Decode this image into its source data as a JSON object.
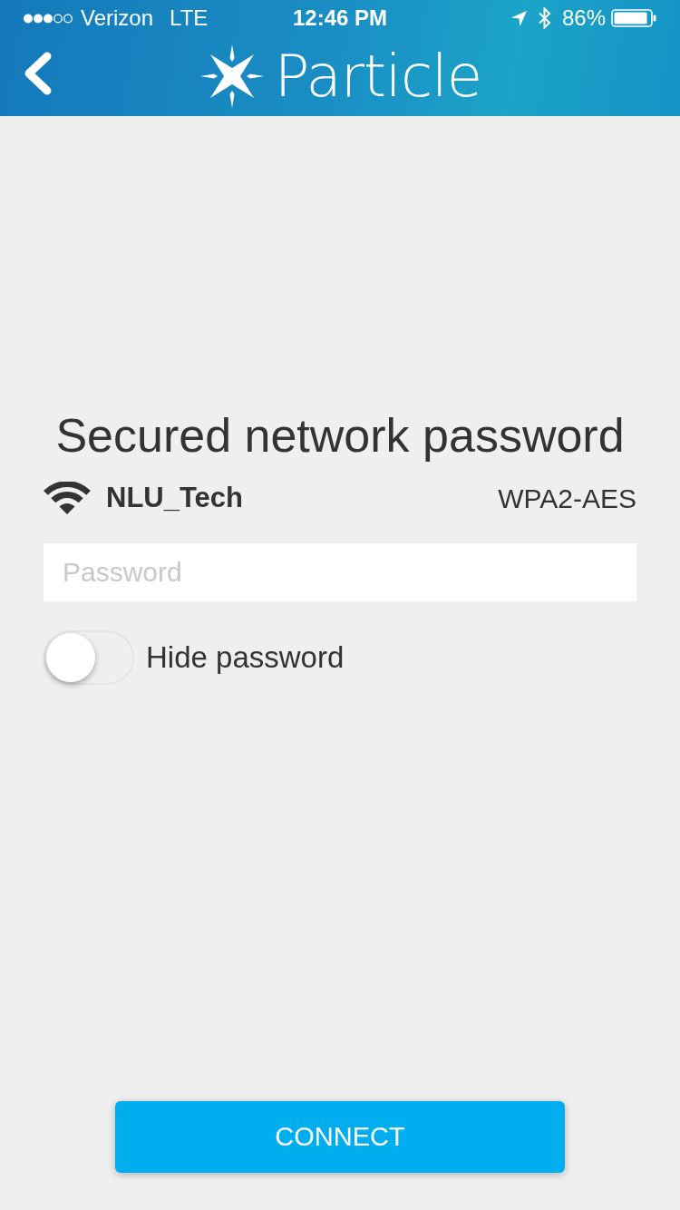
{
  "status_bar": {
    "carrier": "Verizon",
    "network": "LTE",
    "time": "12:46 PM",
    "battery": "86%"
  },
  "nav_bar": {
    "logo_text": "Particle"
  },
  "heading": "Secured network password",
  "network": {
    "name": "NLU_Tech",
    "security": "WPA2-AES"
  },
  "password_field": {
    "placeholder": "Password"
  },
  "hide_password": {
    "label": "Hide password",
    "on": false
  },
  "buttons": [
    {
      "label": "CONNECT"
    }
  ]
}
